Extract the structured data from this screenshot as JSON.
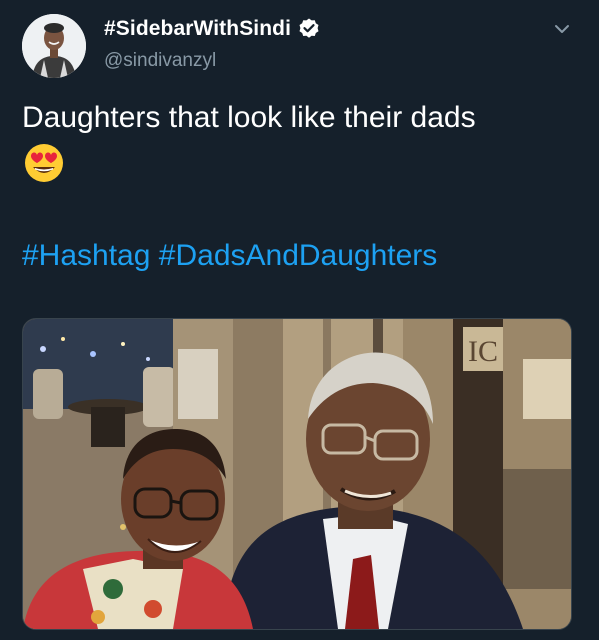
{
  "tweet": {
    "display_name": "#SidebarWithSindi",
    "handle": "@sindivanzyl",
    "verified": true,
    "text": "Daughters that look like their dads",
    "emoji": "smiling-face-with-heart-eyes",
    "hashtags": [
      "#Hashtag",
      "#DadsAndDaughters"
    ],
    "photo_sign": "IC"
  },
  "colors": {
    "background": "#15202b",
    "text": "#ffffff",
    "secondary": "#8899a6",
    "link": "#1da1f2",
    "verified_badge": "#ffffff"
  },
  "icons": {
    "verified": "verified-badge-icon",
    "menu": "chevron-down-icon"
  }
}
